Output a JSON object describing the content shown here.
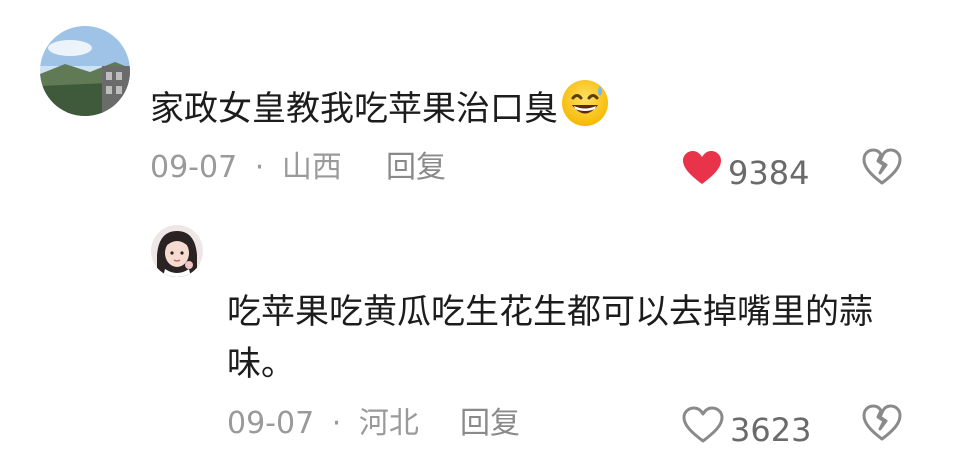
{
  "comments": [
    {
      "text": "家政女皇教我吃苹果治口臭",
      "emoji": "grinning-sweat-emoji",
      "date": "09-07",
      "separator": "·",
      "location": "山西",
      "reply_label": "回复",
      "like_count": "9384",
      "liked": true,
      "like_color": "#e8334a"
    },
    {
      "text": "吃苹果吃黄瓜吃生花生都可以去掉嘴里的蒜味。",
      "date": "09-07",
      "separator": "·",
      "location": "河北",
      "reply_label": "回复",
      "like_count": "3623",
      "liked": false
    }
  ],
  "colors": {
    "text": "#1c1c1c",
    "meta": "#9a9a9a",
    "liked_heart": "#e8334a",
    "icon_gray": "#8a8a8a"
  }
}
